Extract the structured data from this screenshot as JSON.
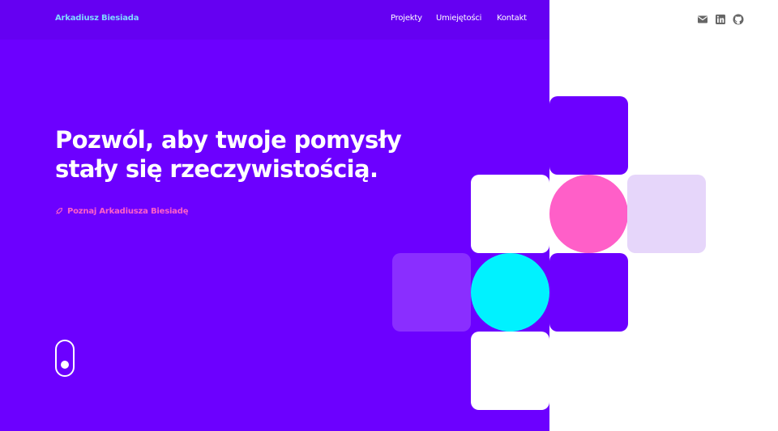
{
  "header": {
    "brand": "Arkadiusz Biesiada",
    "nav": [
      {
        "label": "Projekty"
      },
      {
        "label": "Umiejętości"
      },
      {
        "label": "Kontakt"
      }
    ],
    "social": [
      {
        "icon": "mail-icon"
      },
      {
        "icon": "linkedin-icon"
      },
      {
        "icon": "github-icon"
      }
    ]
  },
  "hero": {
    "headline_line1": "Pozwól, aby twoje pomysły",
    "headline_line2": "stały się rzeczywistością.",
    "cta_label": "Poznaj Arkadiusza Biesiadę"
  },
  "colors": {
    "primary_purple": "#6c00ff",
    "accent_cyan": "#00f2ff",
    "accent_pink": "#ff5fc8",
    "light_lilac": "#e6d6fa",
    "brand_text": "#7fd9ff"
  }
}
